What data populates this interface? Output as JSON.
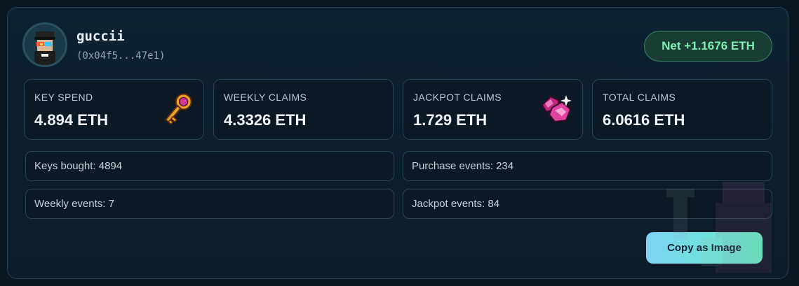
{
  "user": {
    "name": "guccii",
    "address": "(0x04f5...47e1)"
  },
  "net": {
    "label": "Net +1.1676 ETH"
  },
  "stats": [
    {
      "label": "KEY SPEND",
      "value": "4.894 ETH",
      "icon": "key-icon"
    },
    {
      "label": "WEEKLY CLAIMS",
      "value": "4.3326 ETH",
      "icon": ""
    },
    {
      "label": "JACKPOT CLAIMS",
      "value": "1.729 ETH",
      "icon": "gem-icon"
    },
    {
      "label": "TOTAL CLAIMS",
      "value": "6.0616 ETH",
      "icon": ""
    }
  ],
  "info": {
    "keys_bought": "Keys bought: 4894",
    "purchase_events": "Purchase events: 234",
    "weekly_events": "Weekly events: 7",
    "jackpot_events": "Jackpot events: 84"
  },
  "actions": {
    "copy_label": "Copy as Image"
  },
  "colors": {
    "background": "#0a1620",
    "card": "#0f2231",
    "net_text": "#7ff0b5",
    "button_start": "#7fd2f7",
    "button_end": "#62efc0"
  }
}
